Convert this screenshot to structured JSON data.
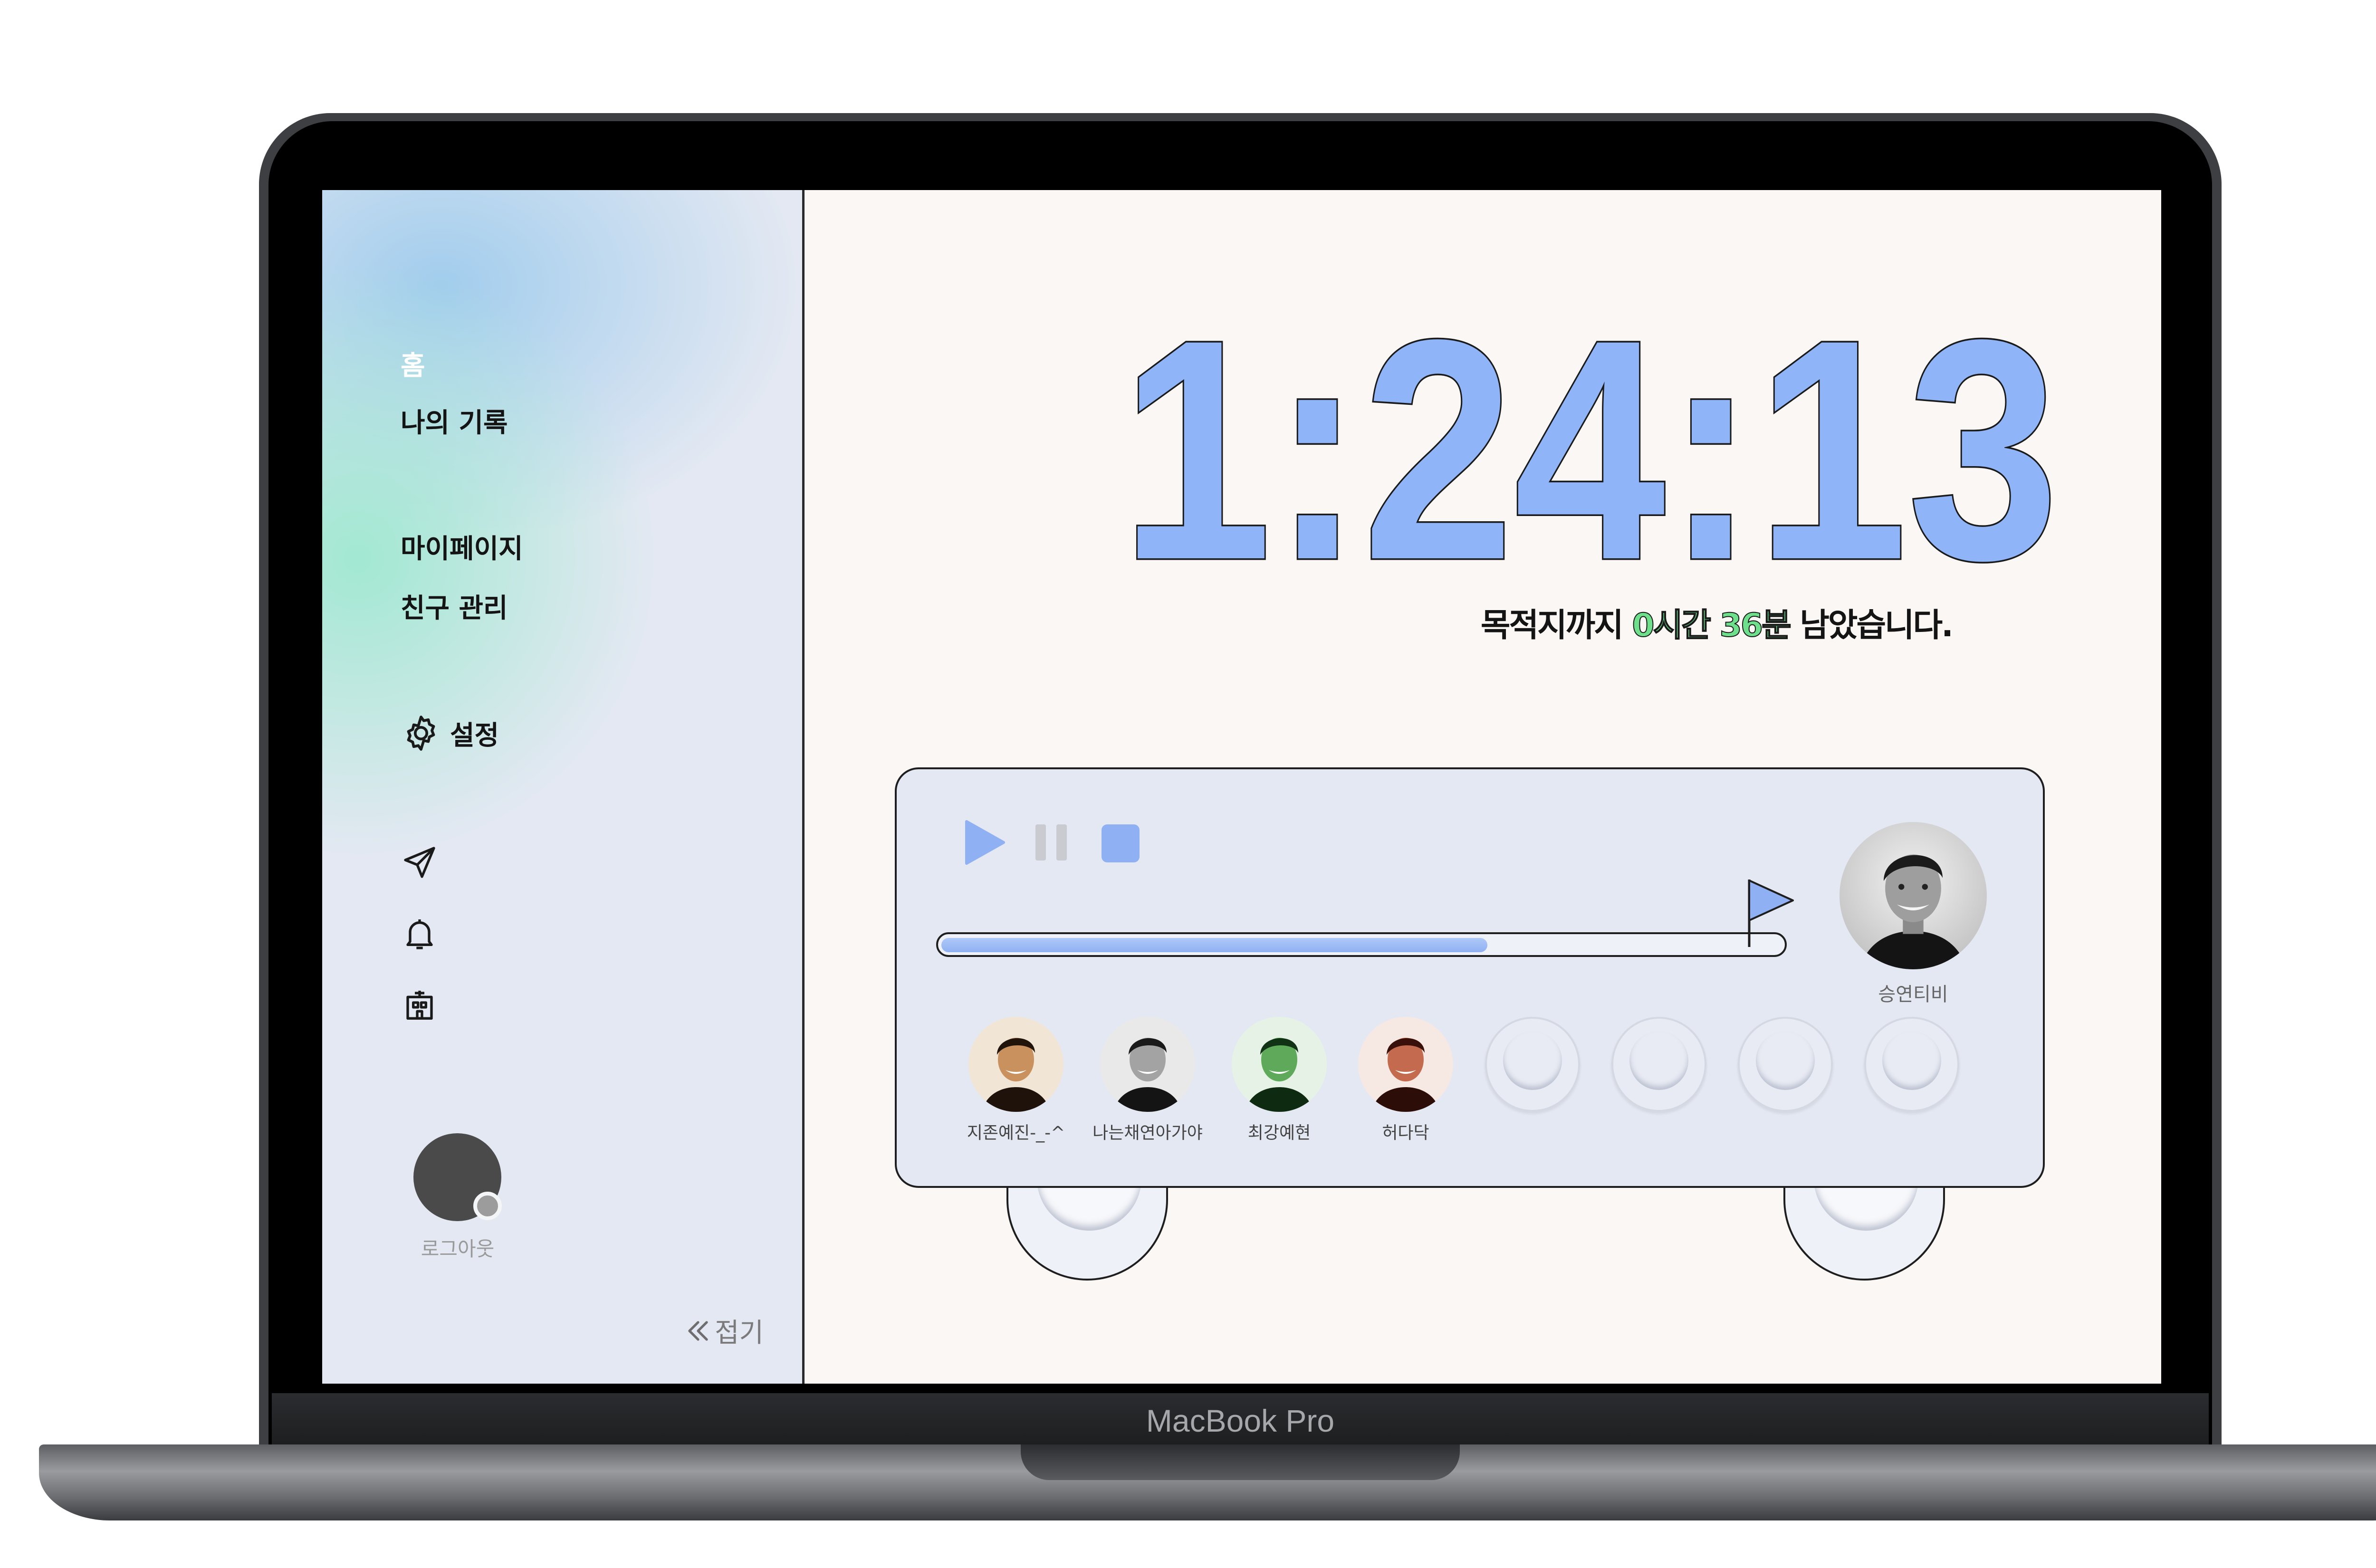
{
  "device": {
    "brand_label": "MacBook Pro"
  },
  "sidebar": {
    "nav": [
      {
        "label": "홈"
      },
      {
        "label": "나의 기록"
      },
      {
        "label": "마이페이지"
      },
      {
        "label": "친구 관리"
      }
    ],
    "settings_label": "설정",
    "icons": [
      "send-icon",
      "bell-icon",
      "building-icon"
    ],
    "logout_label": "로그아웃",
    "collapse_label": "접기"
  },
  "timer": {
    "display": "1:24:13",
    "color": "#8fb4f8"
  },
  "remaining": {
    "prefix": "목적지까지 ",
    "time": "0시간 36분",
    "suffix": " 남았습니다."
  },
  "player": {
    "controls": [
      "play-icon",
      "pause-icon",
      "stop-icon"
    ],
    "progress": 0.65,
    "accent": "#8fb0f2",
    "leader": {
      "name": "승연티비"
    },
    "members": [
      {
        "name": "지존예진-_-^",
        "tint": "warm"
      },
      {
        "name": "나는채연아가야",
        "tint": "gray"
      },
      {
        "name": "최강예현",
        "tint": "green"
      },
      {
        "name": "허다닥",
        "tint": "red"
      }
    ],
    "empty_slots": 4
  }
}
